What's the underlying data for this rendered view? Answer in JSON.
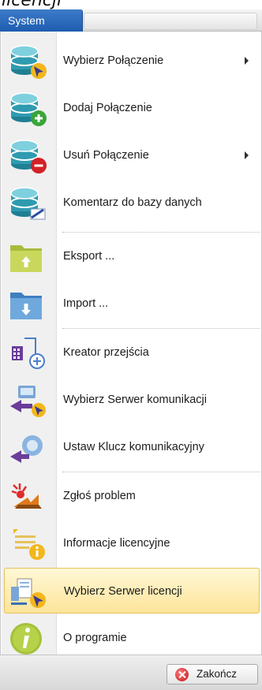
{
  "top_fragment": "licencji",
  "tab": {
    "label": "System"
  },
  "menu": {
    "items": [
      {
        "label": "Wybierz Połączenie",
        "icon": "database-select-icon",
        "has_submenu": true
      },
      {
        "label": "Dodaj Połączenie",
        "icon": "database-add-icon",
        "has_submenu": false
      },
      {
        "label": "Usuń Połączenie",
        "icon": "database-remove-icon",
        "has_submenu": true
      },
      {
        "label": "Komentarz do bazy danych",
        "icon": "database-comment-icon",
        "has_submenu": false
      },
      {
        "label": "Eksport ...",
        "icon": "folder-export-icon",
        "has_submenu": false
      },
      {
        "label": "Import ...",
        "icon": "folder-import-icon",
        "has_submenu": false
      },
      {
        "label": "Kreator przejścia",
        "icon": "migration-wizard-icon",
        "has_submenu": false
      },
      {
        "label": "Wybierz Serwer komunikacji",
        "icon": "communication-server-icon",
        "has_submenu": false
      },
      {
        "label": "Ustaw Klucz komunikacyjny",
        "icon": "communication-key-icon",
        "has_submenu": false
      },
      {
        "label": "Zgłoś problem",
        "icon": "report-problem-icon",
        "has_submenu": false
      },
      {
        "label": "Informacje licencyjne",
        "icon": "license-info-icon",
        "has_submenu": false
      },
      {
        "label": "Wybierz Serwer licencji",
        "icon": "license-server-icon",
        "has_submenu": false,
        "highlighted": true
      },
      {
        "label": "O programie",
        "icon": "about-info-icon",
        "has_submenu": false
      }
    ]
  },
  "footer": {
    "exit_label": "Zakończ"
  },
  "colors": {
    "tab_blue": "#2a6bbd",
    "highlight": "#fde49a",
    "database_teal": "#2f9bb0",
    "folder_green": "#b8c94a",
    "folder_blue": "#5b9bd5",
    "exit_red": "#d42026"
  }
}
